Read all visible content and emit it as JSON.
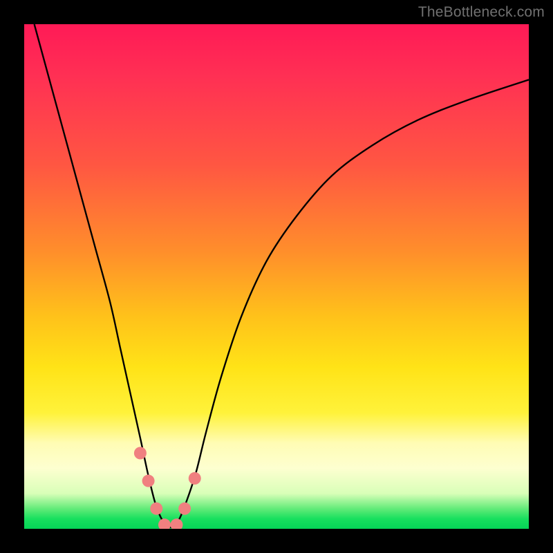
{
  "watermark": "TheBottleneck.com",
  "chart_data": {
    "type": "line",
    "title": "",
    "xlabel": "",
    "ylabel": "",
    "xlim": [
      0,
      100
    ],
    "ylim": [
      0,
      100
    ],
    "series": [
      {
        "name": "curve",
        "x": [
          2,
          5,
          8,
          11,
          14,
          17,
          19,
          21,
          23,
          24.5,
          26,
          27.5,
          29,
          30.5,
          32,
          34,
          36,
          39,
          43,
          48,
          54,
          61,
          69,
          78,
          88,
          100
        ],
        "values": [
          100,
          89,
          78,
          67,
          56,
          45,
          36,
          27,
          18,
          11,
          5,
          1.5,
          0.3,
          1.5,
          5,
          11,
          19,
          30,
          42,
          53,
          62,
          70,
          76,
          81,
          85,
          89
        ]
      }
    ],
    "markers": [
      {
        "name": "left-upper",
        "x": 23.0,
        "y": 15.0
      },
      {
        "name": "left-mid",
        "x": 24.6,
        "y": 9.5
      },
      {
        "name": "left-lower",
        "x": 26.2,
        "y": 4.0
      },
      {
        "name": "bottom-left",
        "x": 27.8,
        "y": 0.8
      },
      {
        "name": "bottom-right",
        "x": 30.2,
        "y": 0.8
      },
      {
        "name": "right-lower",
        "x": 31.8,
        "y": 4.0
      },
      {
        "name": "right-upper",
        "x": 33.8,
        "y": 10.0
      }
    ],
    "marker_color": "#f08080",
    "curve_color": "#000000"
  }
}
